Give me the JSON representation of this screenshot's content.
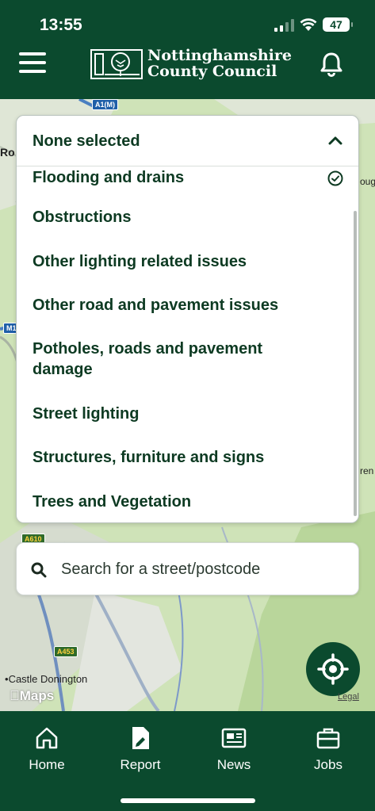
{
  "status_bar": {
    "time": "13:55",
    "battery": "47"
  },
  "header": {
    "logo_line1": "Nottinghamshire",
    "logo_line2": "County Council"
  },
  "dropdown": {
    "selected_label": "None selected",
    "items": [
      {
        "label": "Flooding and drains",
        "checked": true
      },
      {
        "label": "Obstructions",
        "checked": false
      },
      {
        "label": "Other lighting related issues",
        "checked": false
      },
      {
        "label": "Other road and pavement issues",
        "checked": false
      },
      {
        "label": "Potholes, roads and pavement damage",
        "checked": false
      },
      {
        "label": "Street lighting",
        "checked": false
      },
      {
        "label": "Structures, furniture and signs",
        "checked": false
      },
      {
        "label": "Trees and Vegetation",
        "checked": false
      }
    ]
  },
  "search": {
    "placeholder": "Search for a street/postcode"
  },
  "map": {
    "road_labels": {
      "a1m": "A1(M)",
      "m1": "M1",
      "a610": "A610",
      "a453": "A453"
    },
    "place_castle": "Castle Donington",
    "edge_ro": "Ro",
    "edge_oug": "oug",
    "edge_ren": "ren",
    "brand": "Maps",
    "legal": "Legal"
  },
  "tabbar": {
    "items": [
      {
        "label": "Home",
        "icon": "home-icon"
      },
      {
        "label": "Report",
        "icon": "report-icon"
      },
      {
        "label": "News",
        "icon": "news-icon"
      },
      {
        "label": "Jobs",
        "icon": "briefcase-icon"
      }
    ]
  },
  "colors": {
    "brand_green": "#0b4a2e",
    "text_dark": "#0d3a22",
    "map_green": "#cfe3b8"
  }
}
